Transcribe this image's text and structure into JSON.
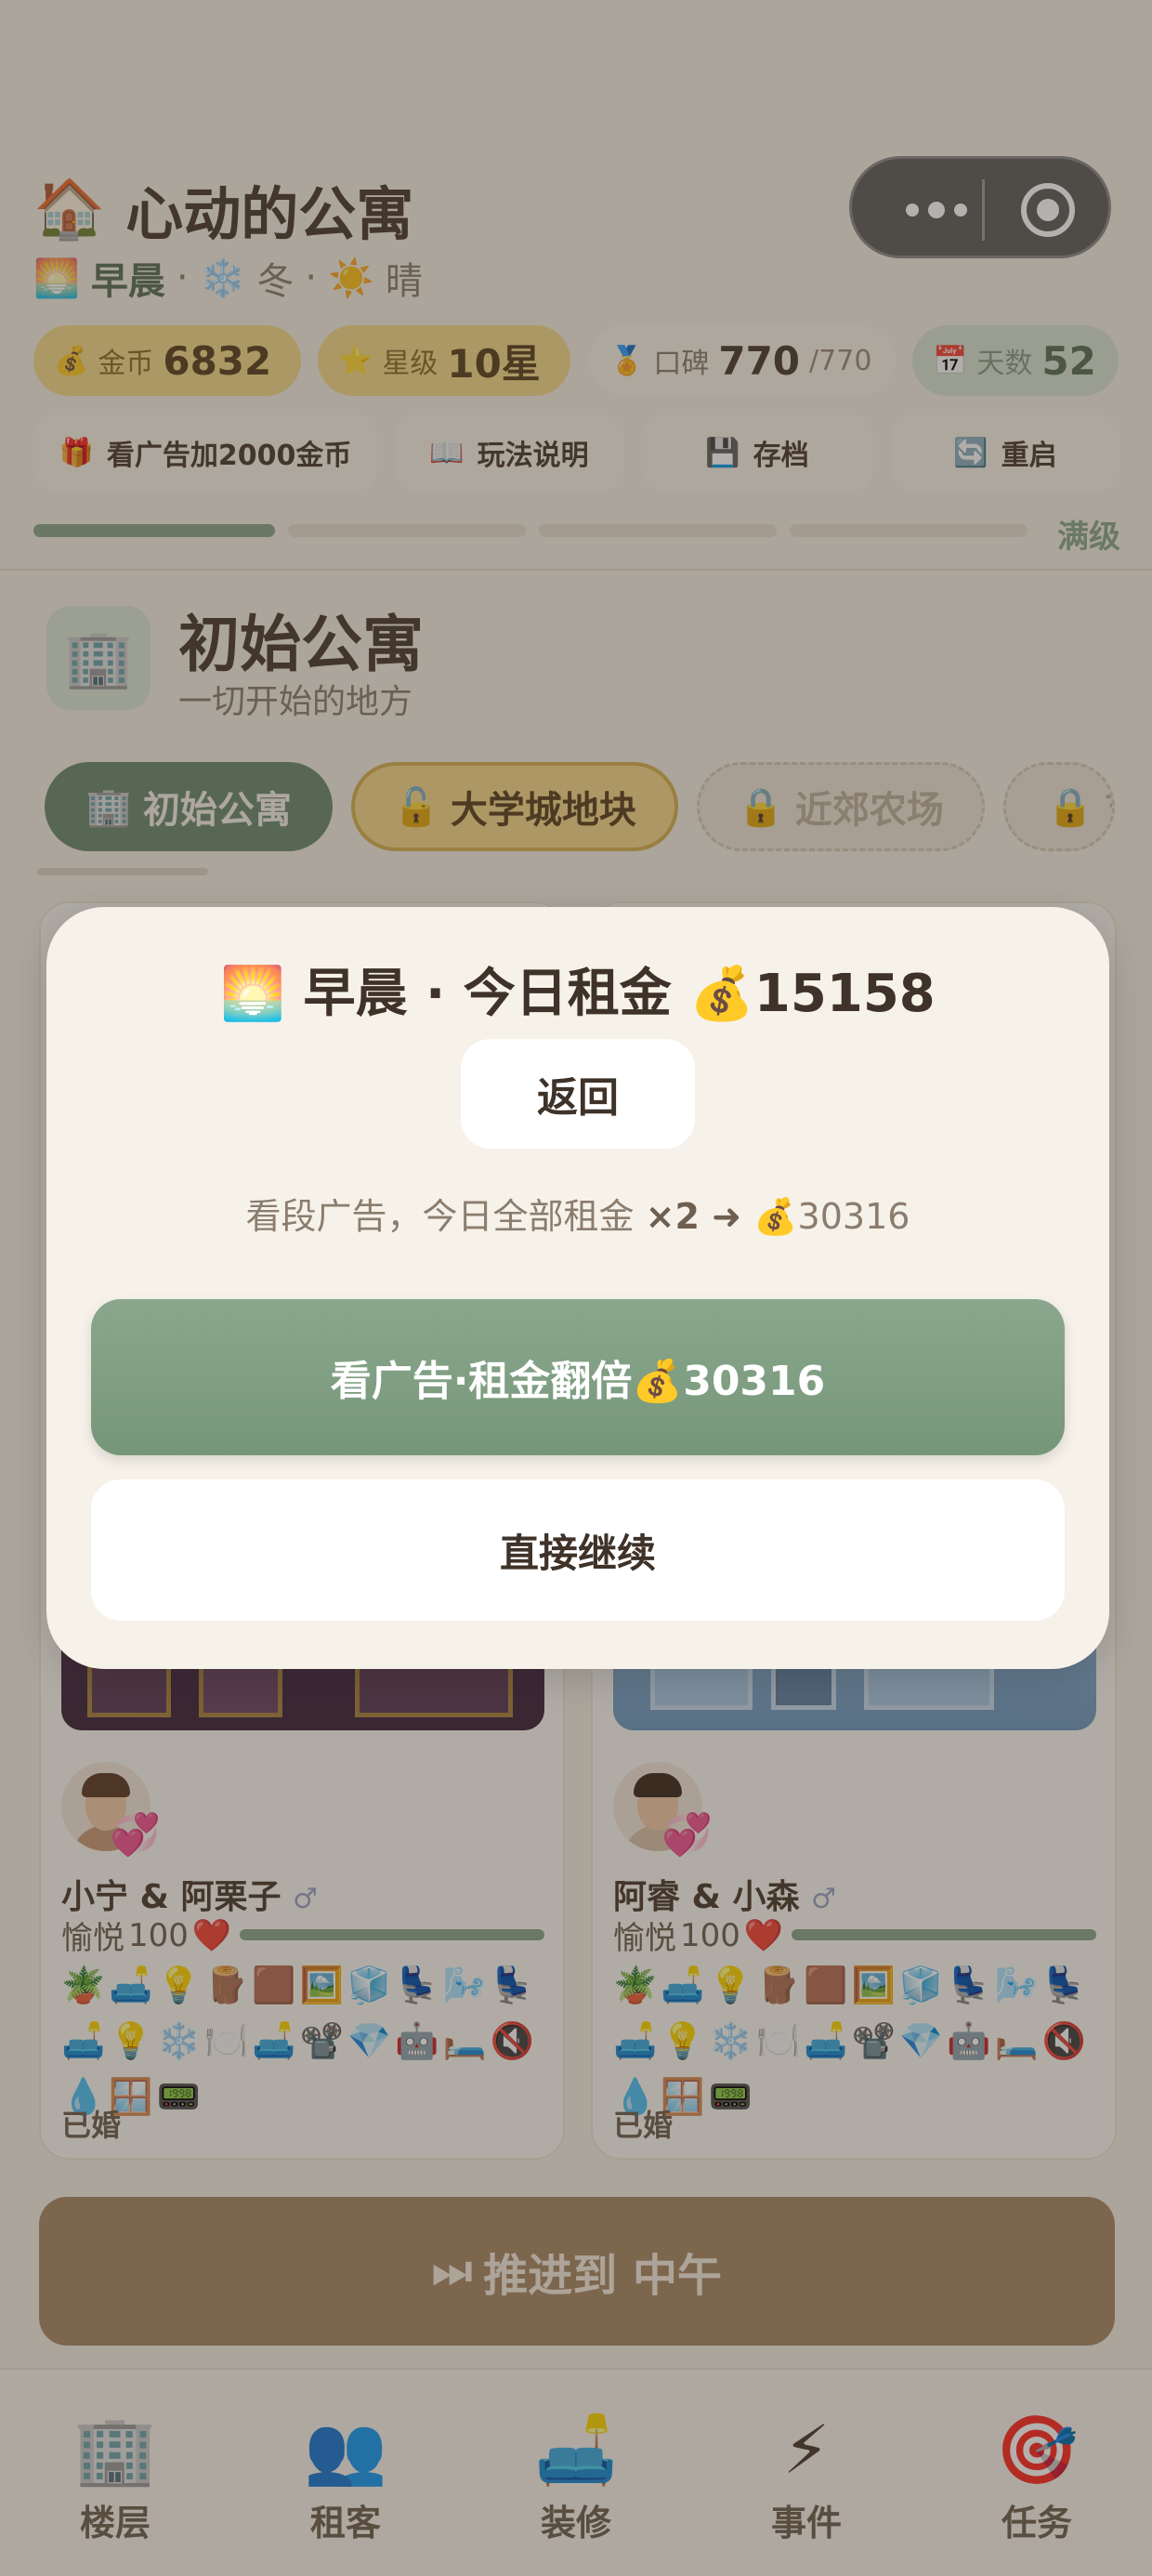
{
  "header": {
    "title_icon": "🏠",
    "title": "心动的公寓",
    "time_icon": "🌅",
    "time_of_day": "早晨",
    "season_icon": "❄️",
    "season": "冬",
    "weather_icon": "☀️",
    "weather": "晴",
    "sep": "·"
  },
  "stats": {
    "coins": {
      "icon": "💰",
      "label": "金币",
      "value": "6832"
    },
    "stars": {
      "icon": "⭐",
      "label": "星级",
      "value": "10星"
    },
    "reputation": {
      "icon": "🏅",
      "label": "口碑",
      "value": "770",
      "max": "/770"
    },
    "days": {
      "icon": "📅",
      "label": "天数",
      "value": "52"
    }
  },
  "actions": [
    {
      "icon": "🎁",
      "label": "看广告加2000金币"
    },
    {
      "icon": "📖",
      "label": "玩法说明"
    },
    {
      "icon": "💾",
      "label": "存档"
    },
    {
      "icon": "🔄",
      "label": "重启"
    }
  ],
  "level_progress": {
    "label": "满级",
    "segments_filled": 1,
    "segments_total": 4
  },
  "apartment": {
    "icon": "🏢",
    "name": "初始公寓",
    "subtitle": "一切开始的地方"
  },
  "location_tabs": [
    {
      "icon": "🏢",
      "label": "初始公寓",
      "state": "active"
    },
    {
      "icon": "🔓",
      "label": "大学城地块",
      "state": "unlockable"
    },
    {
      "icon": "🔒",
      "label": "近郊农场",
      "state": "locked"
    },
    {
      "icon": "🔒",
      "label": "艺",
      "state": "locked"
    }
  ],
  "tenants": [
    {
      "names": "小宁 & 阿栗子",
      "gender": "♂",
      "mood_label": "愉悦",
      "mood_value": "100",
      "mood_icon": "❤️",
      "mood_fraction": 1.0,
      "furniture": "🪴🛋️💡🪵🟫🖼️🧊💺🌬️💺🛋️💡❄️🍽️🛋️📽️💎🤖🛏️🔇💧🪟📟",
      "status": "已婚",
      "badge": "💞"
    },
    {
      "names": "阿睿 & 小森",
      "gender": "♂",
      "mood_label": "愉悦",
      "mood_value": "100",
      "mood_icon": "❤️",
      "mood_fraction": 1.0,
      "furniture": "🪴🛋️💡🪵🟫🖼️🧊💺🌬️💺🛋️💡❄️🍽️🛋️📽️💎🤖🛏️🔇💧🪟📟",
      "status": "已婚",
      "badge": "💞"
    }
  ],
  "advance_button": {
    "icon": "⏭",
    "label": "推进到 中午"
  },
  "tabbar": [
    {
      "icon": "🏢",
      "label": "楼层"
    },
    {
      "icon": "👥",
      "label": "租客"
    },
    {
      "icon": "🛋️",
      "label": "装修"
    },
    {
      "icon": "⚡",
      "label": "事件"
    },
    {
      "icon": "🎯",
      "label": "任务"
    }
  ],
  "modal": {
    "title": "🌅 早晨 · 今日租金 💰15158",
    "back_label": "返回",
    "hint_prefix": "看段广告，今日全部租金 ",
    "hint_mult": "×2 ➜ ",
    "hint_value": "💰30316",
    "ad_button_label": "看广告·租金翻倍💰30316",
    "continue_label": "直接继续"
  }
}
